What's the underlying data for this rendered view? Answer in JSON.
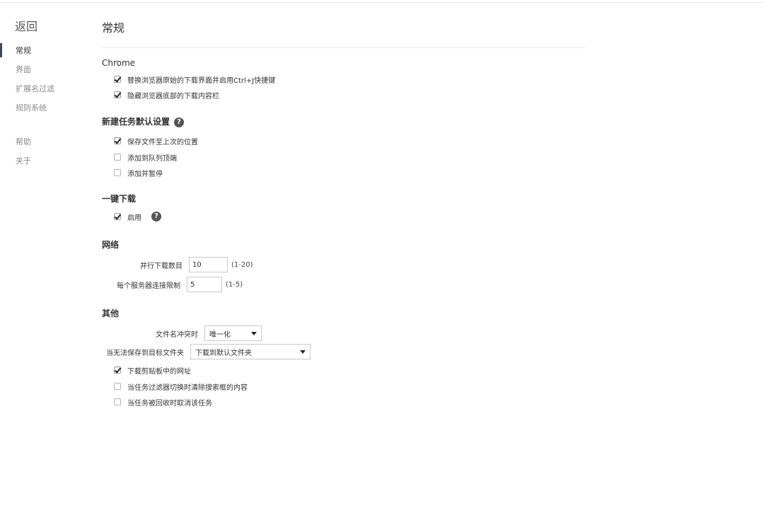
{
  "sidebar": {
    "back_label": "返回",
    "items": [
      {
        "label": "常规"
      },
      {
        "label": "界面"
      },
      {
        "label": "扩展名过滤"
      },
      {
        "label": "规则系统"
      },
      {
        "label": "帮助"
      },
      {
        "label": "关于"
      }
    ]
  },
  "main": {
    "title": "常规",
    "chrome": {
      "title": "Chrome",
      "options": [
        {
          "label": "替换浏览器原始的下载界面并启用Ctrl+J快捷键",
          "checked": true
        },
        {
          "label": "隐藏浏览器底部的下载内容栏",
          "checked": true
        }
      ]
    },
    "new_task": {
      "title": "新建任务默认设置",
      "options": [
        {
          "label": "保存文件至上次的位置",
          "checked": true
        },
        {
          "label": "添加到队列顶端",
          "checked": false
        },
        {
          "label": "添加并暂停",
          "checked": false
        }
      ]
    },
    "one_click": {
      "title": "一键下载",
      "options": [
        {
          "label": "启用",
          "checked": true
        }
      ]
    },
    "network": {
      "title": "网络",
      "parallel_label": "并行下载数目",
      "parallel_value": "10",
      "parallel_hint": "(1-20)",
      "per_server_label": "每个服务器连接限制",
      "per_server_value": "5",
      "per_server_hint": "(1-5)"
    },
    "other": {
      "title": "其他",
      "conflict_label": "文件名冲突时",
      "conflict_value": "唯一化",
      "cannot_save_label": "当无法保存到目标文件夹",
      "cannot_save_value": "下载到默认文件夹",
      "options": [
        {
          "label": "下载剪贴板中的网址",
          "checked": true
        },
        {
          "label": "当任务过滤器切换时清除搜索框的内容",
          "checked": false
        },
        {
          "label": "当任务被回收时取消该任务",
          "checked": false
        }
      ]
    },
    "help_glyph": "?"
  }
}
